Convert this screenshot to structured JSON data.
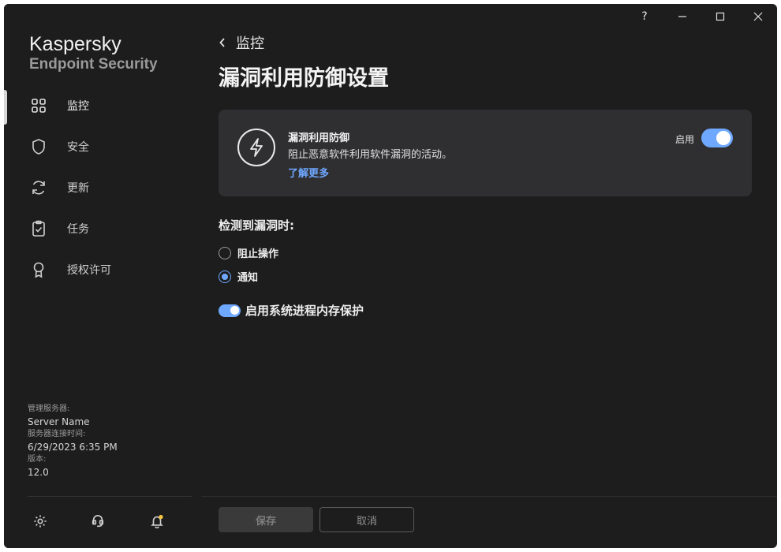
{
  "brand": {
    "name": "Kaspersky",
    "product": "Endpoint Security"
  },
  "titlebar": {
    "help": "?",
    "minimize": "",
    "maximize": "",
    "close": ""
  },
  "nav": {
    "items": [
      {
        "label": "监控",
        "icon": "dashboard-icon"
      },
      {
        "label": "安全",
        "icon": "shield-icon"
      },
      {
        "label": "更新",
        "icon": "refresh-icon"
      },
      {
        "label": "任务",
        "icon": "clipboard-icon"
      },
      {
        "label": "授权许可",
        "icon": "license-icon"
      }
    ]
  },
  "server": {
    "admin_label": "管理服务器:",
    "admin_value": "Server Name",
    "conn_label": "服务器连接时间:",
    "conn_value": "6/29/2023 6:35 PM",
    "version_label": "版本:",
    "version_value": "12.0"
  },
  "main": {
    "back_label": "监控",
    "title": "漏洞利用防御设置",
    "card": {
      "title": "漏洞利用防御",
      "description": "阻止恶意软件利用软件漏洞的活动。",
      "link": "了解更多",
      "toggle_label": "启用",
      "enabled": true
    },
    "section_title": "检测到漏洞时:",
    "options": [
      {
        "label": "阻止操作",
        "checked": false
      },
      {
        "label": "通知",
        "checked": true
      }
    ],
    "memory_protection": {
      "label": "启用系统进程内存保护",
      "enabled": true
    }
  },
  "footer": {
    "save": "保存",
    "cancel": "取消"
  },
  "colors": {
    "accent": "#6fa8ff",
    "background": "#1d1d1d",
    "card": "#2f2f32",
    "notification": "#f5c342"
  }
}
